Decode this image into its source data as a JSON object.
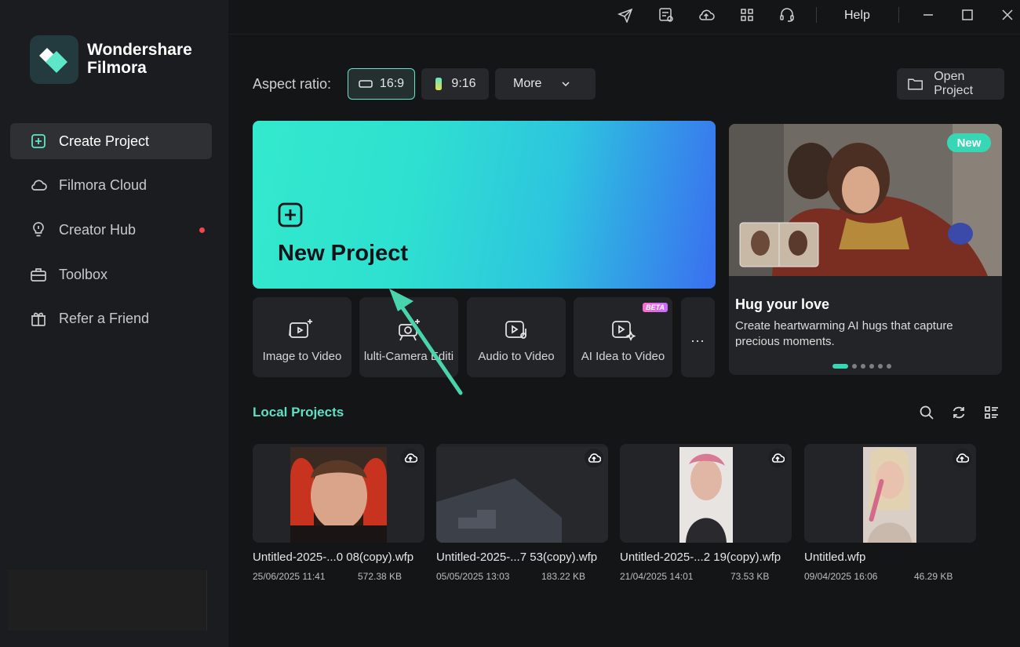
{
  "brand": {
    "line1": "Wondershare",
    "line2": "Filmora"
  },
  "sidebar": {
    "items": [
      {
        "label": "Create Project",
        "icon": "plus-square-icon",
        "active": true
      },
      {
        "label": "Filmora Cloud",
        "icon": "cloud-icon"
      },
      {
        "label": "Creator Hub",
        "icon": "bulb-icon",
        "badge": "red-dot"
      },
      {
        "label": "Toolbox",
        "icon": "toolbox-icon"
      },
      {
        "label": "Refer a Friend",
        "icon": "gift-icon"
      }
    ]
  },
  "titlebar": {
    "help": "Help",
    "icons": [
      "send-icon",
      "feedback-icon",
      "cloud-upload-icon",
      "apps-grid-icon",
      "headset-icon",
      "minimize-icon",
      "maximize-icon",
      "close-icon"
    ]
  },
  "aspect": {
    "label": "Aspect ratio:",
    "options": [
      {
        "label": "16:9",
        "selected": true
      },
      {
        "label": "9:16"
      }
    ],
    "more": "More"
  },
  "open_project": "Open Project",
  "new_project": "New Project",
  "tools": [
    {
      "label": "Image to Video",
      "icon": "image-to-video-icon"
    },
    {
      "label": "lulti-Camera Editi",
      "icon": "multi-camera-icon"
    },
    {
      "label": "Audio to Video",
      "icon": "audio-to-video-icon"
    },
    {
      "label": "AI Idea to Video",
      "icon": "ai-idea-icon",
      "badge": "BETA"
    }
  ],
  "tools_more": "...",
  "promo": {
    "badge": "New",
    "title": "Hug your love",
    "desc": "Create heartwarming AI hugs that capture precious moments.",
    "dots": 6,
    "active_dot": 0
  },
  "local": {
    "title": "Local Projects",
    "icons": [
      "search-icon",
      "refresh-icon",
      "list-view-icon"
    ],
    "projects": [
      {
        "name": "Untitled-2025-...0 08(copy).wfp",
        "date": "25/06/2025 11:41",
        "size": "572.38 KB"
      },
      {
        "name": "Untitled-2025-...7 53(copy).wfp",
        "date": "05/05/2025 13:03",
        "size": "183.22 KB"
      },
      {
        "name": "Untitled-2025-...2 19(copy).wfp",
        "date": "21/04/2025 14:01",
        "size": "73.53 KB"
      },
      {
        "name": "Untitled.wfp",
        "date": "09/04/2025 16:06",
        "size": "46.29 KB"
      }
    ]
  },
  "colors": {
    "accent": "#5fe0c4",
    "badge": "#37d6b5",
    "red_dot": "#f0474f"
  }
}
